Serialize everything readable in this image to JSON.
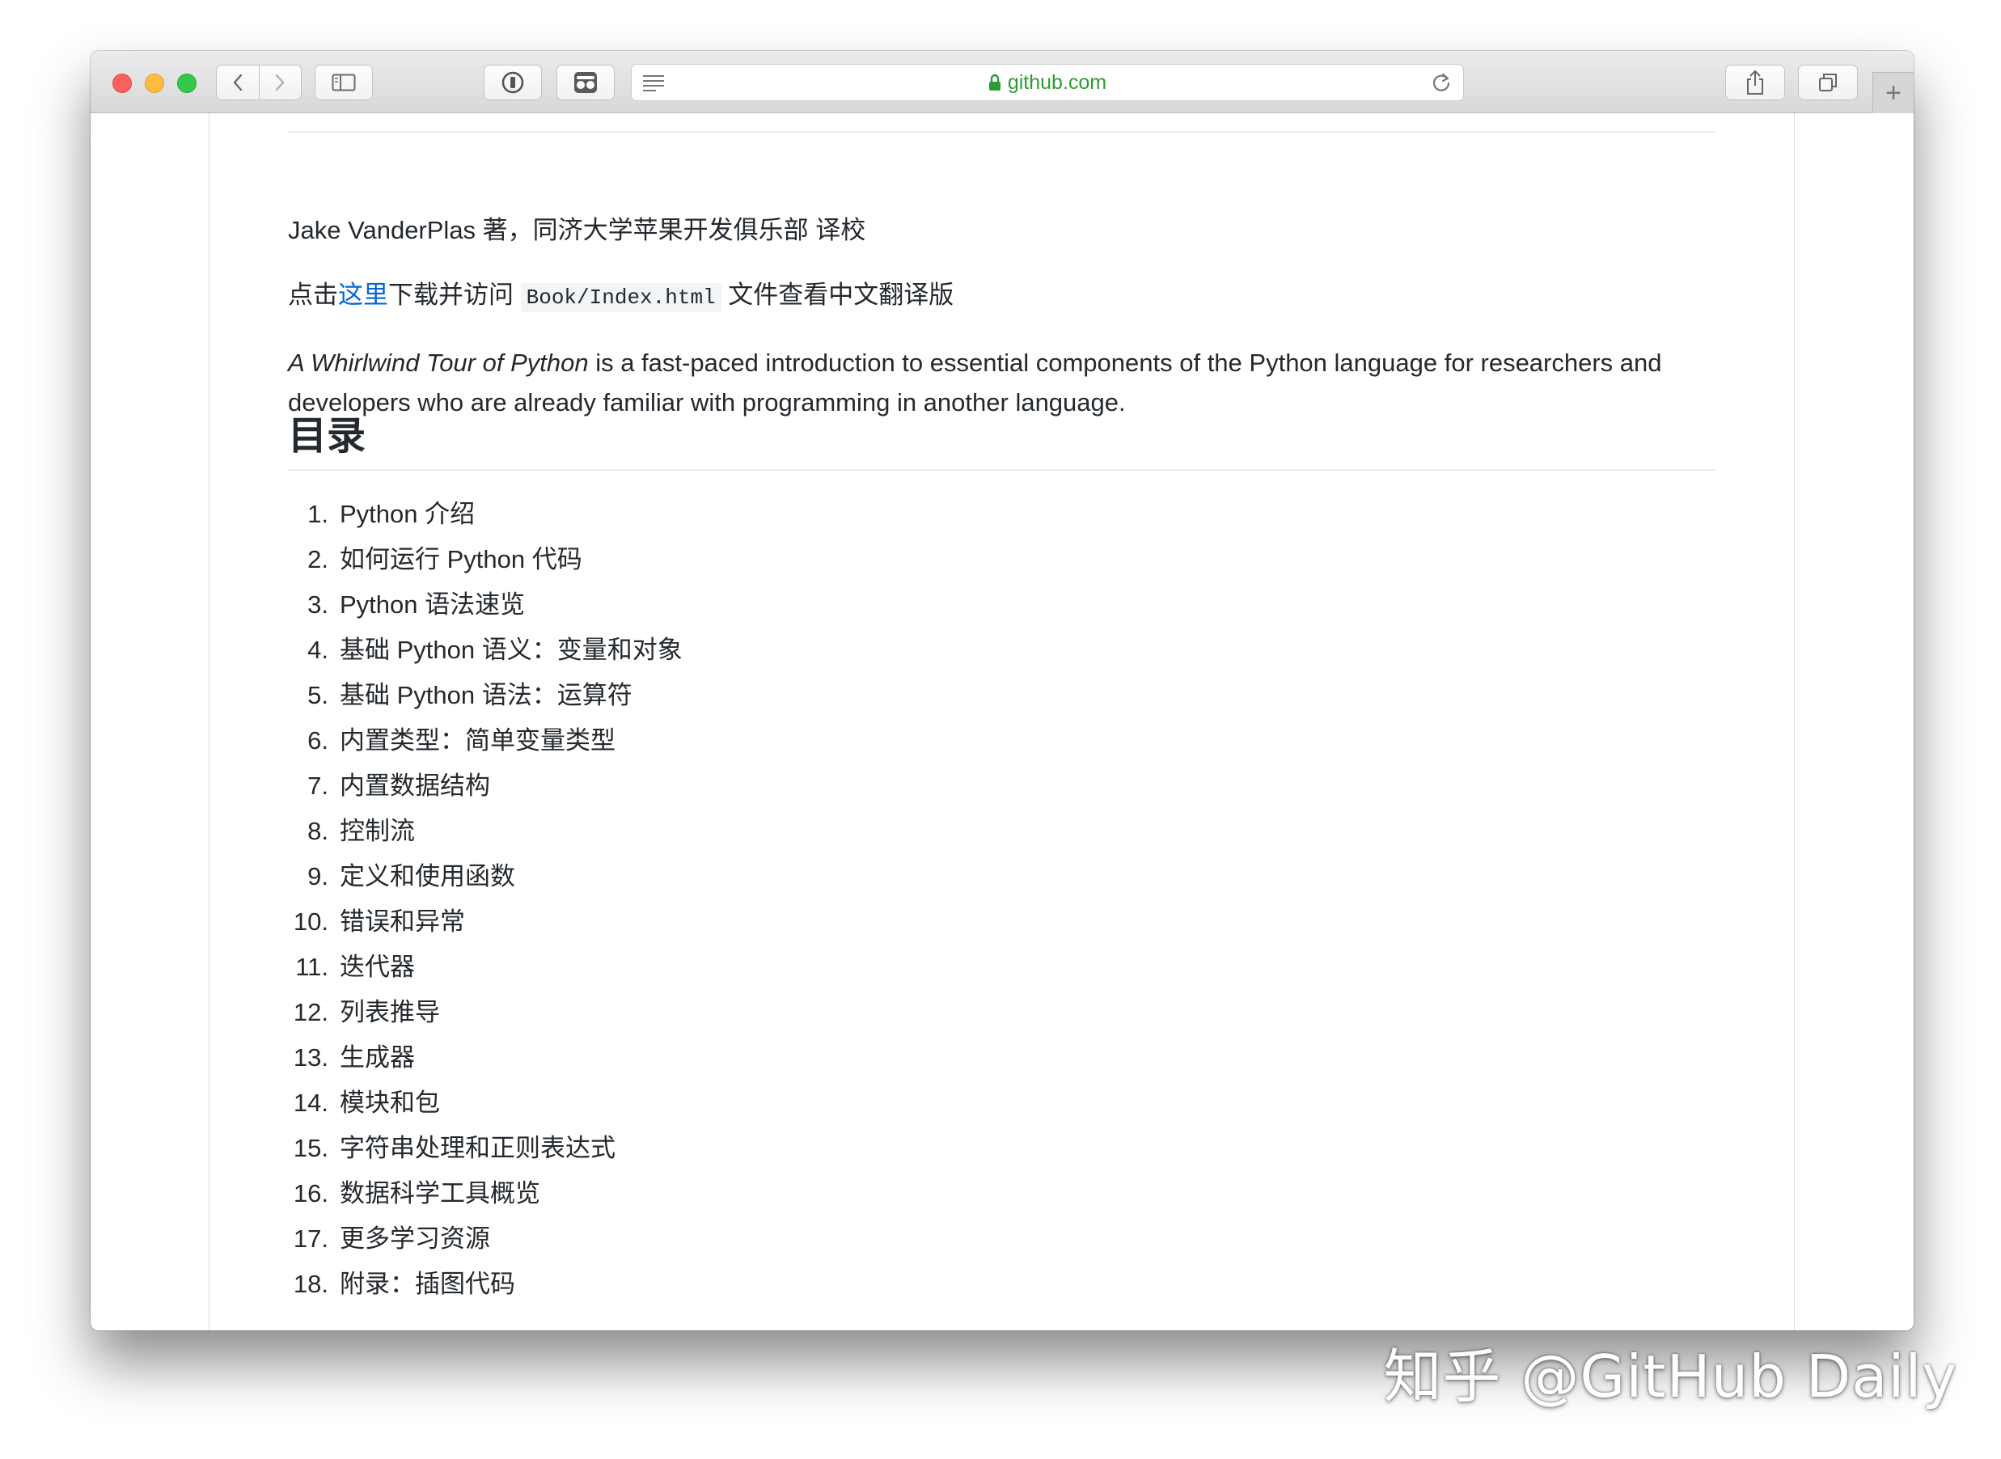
{
  "browser": {
    "url": "github.com",
    "new_tab_symbol": "+",
    "icons": {
      "back": "chevron-left-icon",
      "forward": "chevron-right-icon",
      "sidebar": "sidebar-icon",
      "password": "password-manager-icon",
      "extension": "extension-icon",
      "reader": "reader-view-icon",
      "lock": "lock-icon",
      "reload": "reload-icon",
      "share": "share-icon",
      "tabs": "tab-overview-icon"
    },
    "colors": {
      "close": "#fc605c",
      "minimize": "#fdbc40",
      "zoom": "#34c84a",
      "url_text": "#2f9a35"
    }
  },
  "page": {
    "author_line": "Jake VanderPlas 著，同济大学苹果开发俱乐部 译校",
    "download_line": {
      "prefix": "点击",
      "link": "这里",
      "middle": "下载并访问 ",
      "code": "Book/Index.html",
      "suffix": " 文件查看中文翻译版"
    },
    "intro": {
      "title_italic": "A Whirlwind Tour of Python",
      "text": " is a fast-paced introduction to essential components of the Python language for researchers and developers who are already familiar with programming in another language."
    },
    "toc_heading": "目录",
    "toc_items": [
      {
        "num": "1.",
        "label": "Python 介绍"
      },
      {
        "num": "2.",
        "label": "如何运行 Python 代码"
      },
      {
        "num": "3.",
        "label": "Python 语法速览"
      },
      {
        "num": "4.",
        "label": "基础 Python 语义：变量和对象"
      },
      {
        "num": "5.",
        "label": "基础 Python 语法：运算符"
      },
      {
        "num": "6.",
        "label": "内置类型：简单变量类型"
      },
      {
        "num": "7.",
        "label": "内置数据结构"
      },
      {
        "num": "8.",
        "label": "控制流"
      },
      {
        "num": "9.",
        "label": "定义和使用函数"
      },
      {
        "num": "10.",
        "label": "错误和异常"
      },
      {
        "num": "11.",
        "label": "迭代器"
      },
      {
        "num": "12.",
        "label": "列表推导"
      },
      {
        "num": "13.",
        "label": "生成器"
      },
      {
        "num": "14.",
        "label": "模块和包"
      },
      {
        "num": "15.",
        "label": "字符串处理和正则表达式"
      },
      {
        "num": "16.",
        "label": "数据科学工具概览"
      },
      {
        "num": "17.",
        "label": "更多学习资源"
      },
      {
        "num": "18.",
        "label": "附录：插图代码"
      }
    ],
    "link_color": "#0366d6"
  },
  "watermark": "知乎 @GitHub Daily"
}
